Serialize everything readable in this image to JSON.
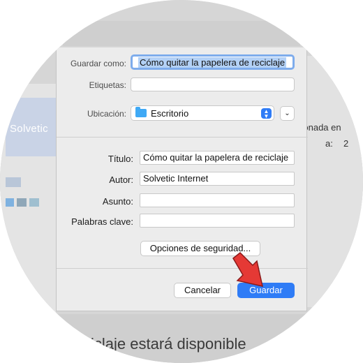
{
  "background": {
    "logo_text": "Solvetic",
    "right_text": "cionada en",
    "right_a": "a:",
    "right_num": "2",
    "bottom_text": "iclaje estará disponible"
  },
  "dialog": {
    "save_as_label": "Guardar como:",
    "save_as_value": "Cómo quitar la papelera de reciclaje",
    "tags_label": "Etiquetas:",
    "tags_value": "",
    "location_label": "Ubicación:",
    "location_value": "Escritorio",
    "title_label": "Título:",
    "title_value": "Cómo quitar la papelera de reciclaje",
    "author_label": "Autor:",
    "author_value": "Solvetic Internet",
    "subject_label": "Asunto:",
    "subject_value": "",
    "keywords_label": "Palabras clave:",
    "keywords_value": "",
    "security_button": "Opciones de seguridad...",
    "cancel_button": "Cancelar",
    "save_button": "Guardar"
  },
  "colors": {
    "accent": "#2f7cf6",
    "arrow": "#e53935",
    "selection": "#b3d1f6"
  }
}
